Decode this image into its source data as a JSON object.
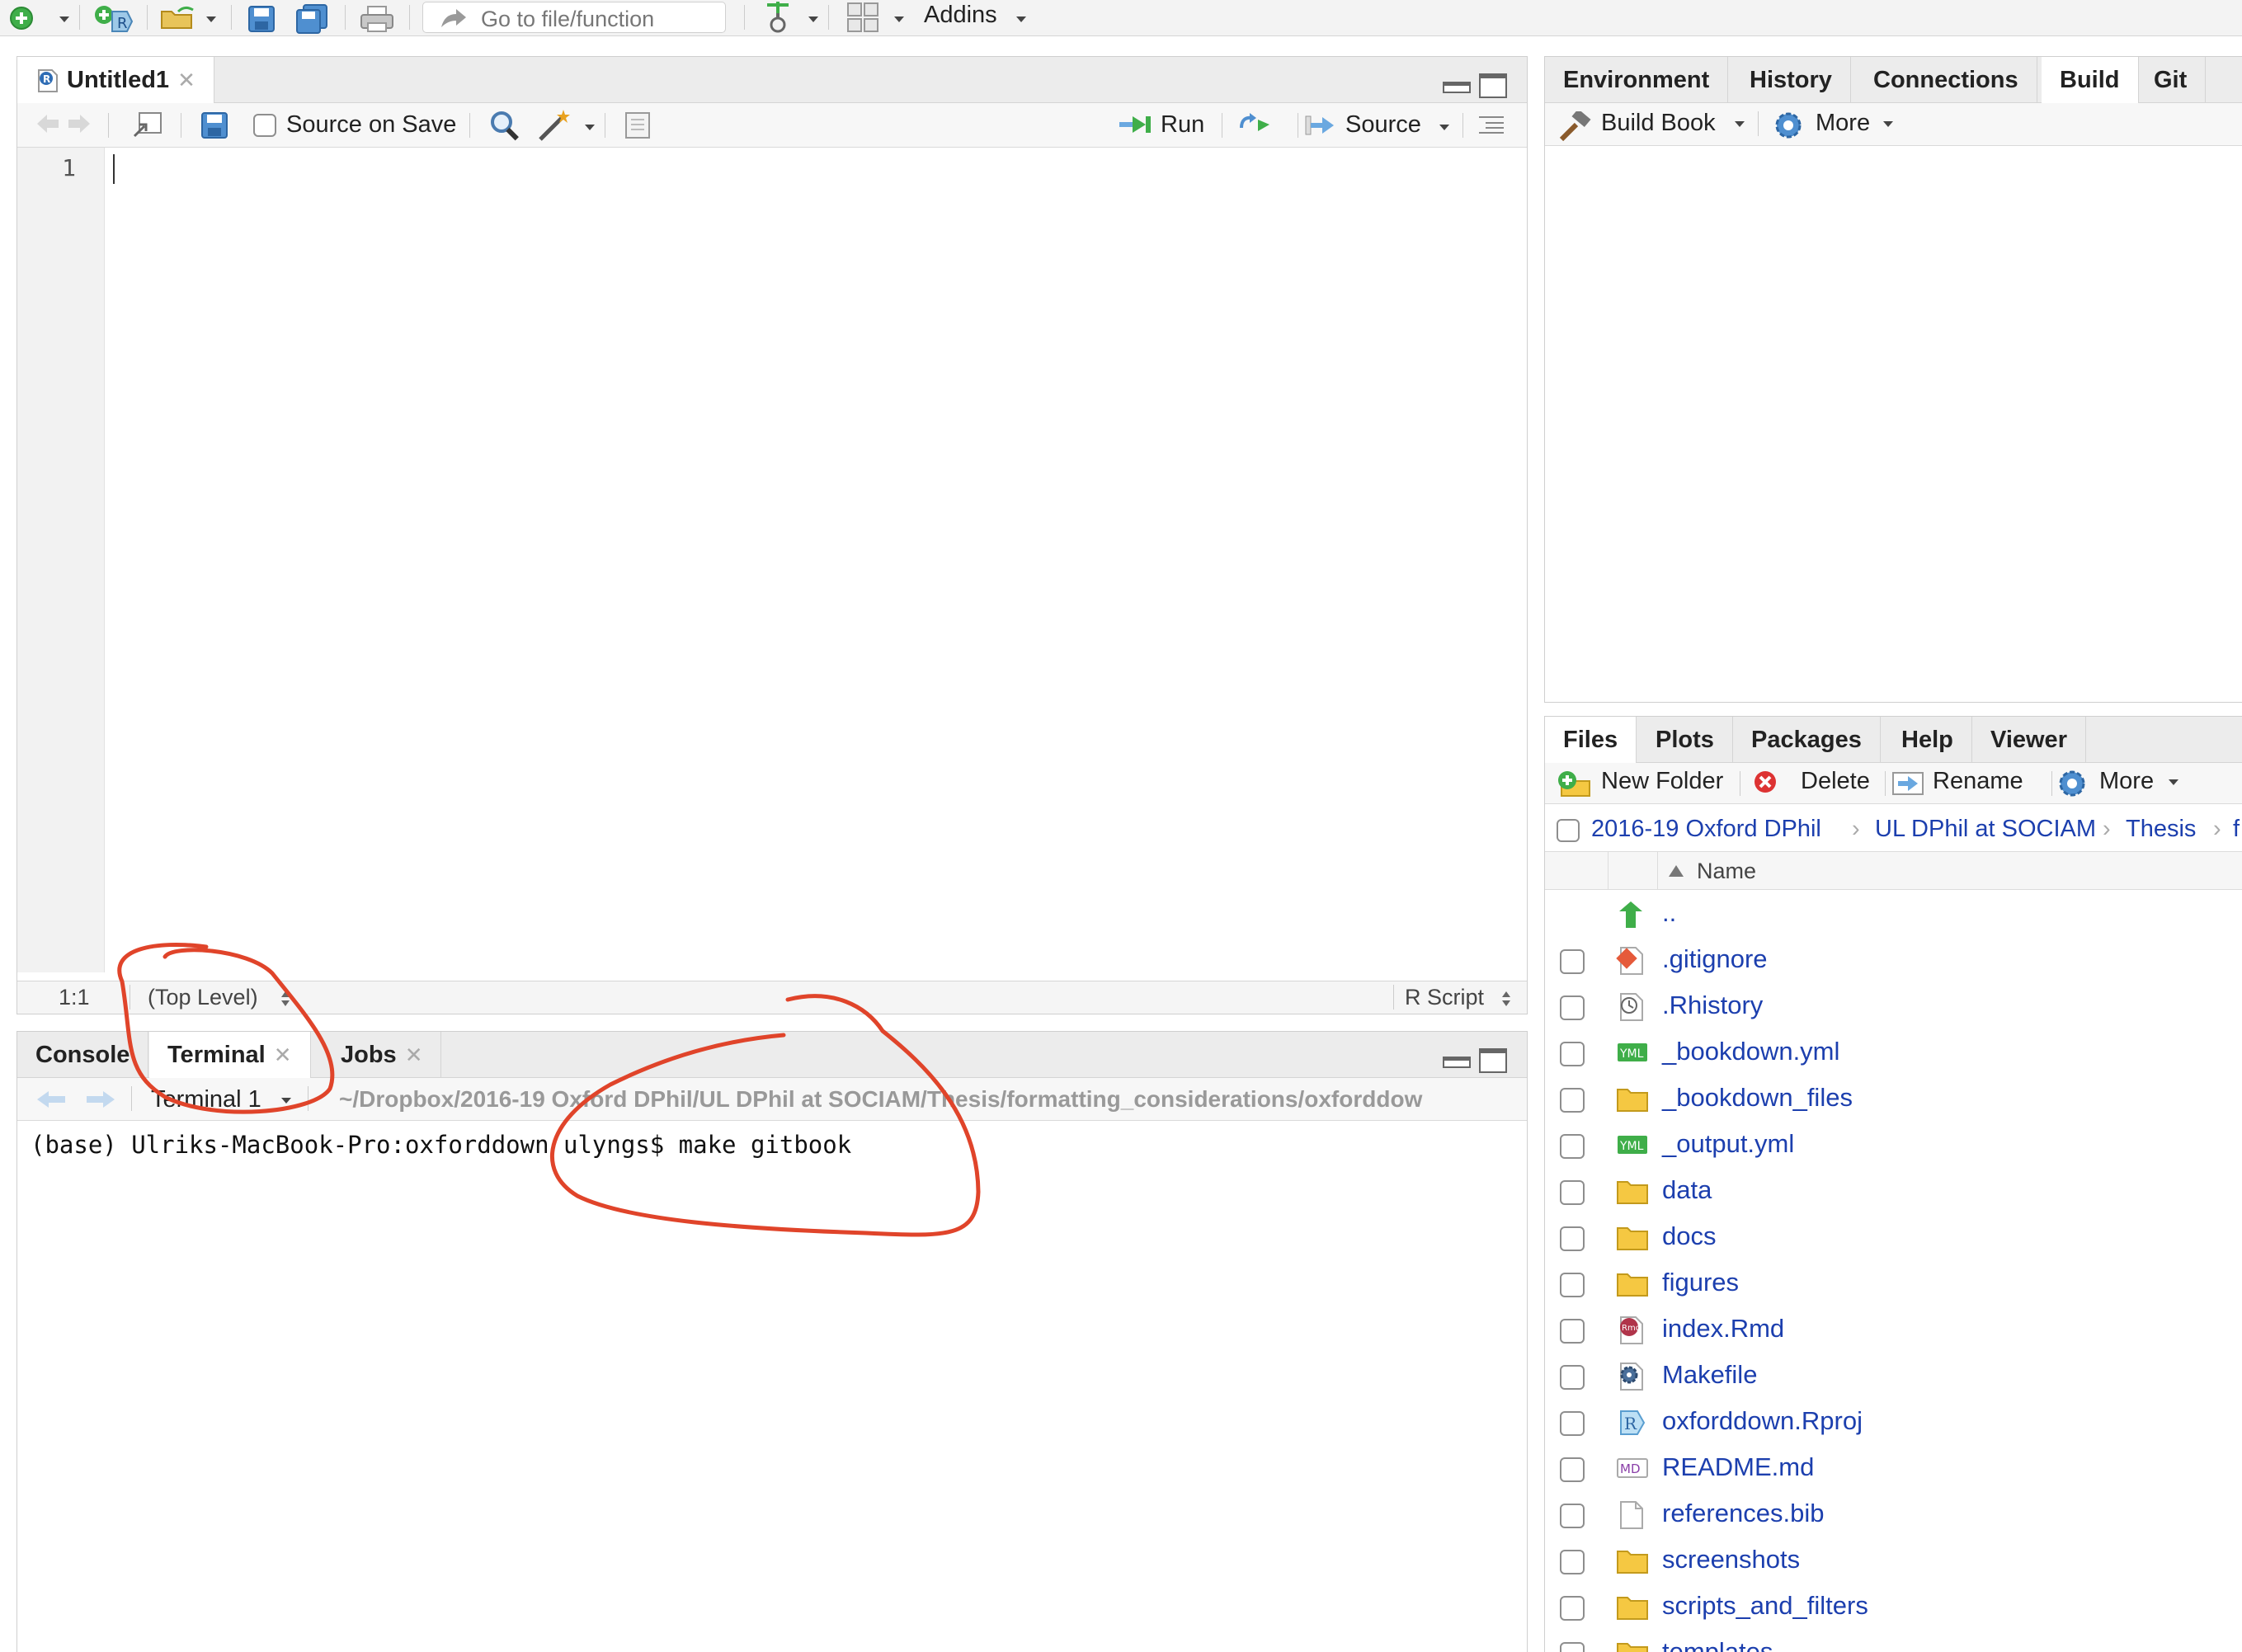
{
  "toolbar": {
    "goto_placeholder": "Go to file/function",
    "addins_label": "Addins"
  },
  "source_pane": {
    "tab_label": "Untitled1",
    "source_on_save_label": "Source on Save",
    "run_label": "Run",
    "source_label": "Source",
    "line_number": "1",
    "cursor_position": "1:1",
    "scope_label": "(Top Level)",
    "file_type": "R Script"
  },
  "console_pane": {
    "tabs": [
      "Console",
      "Terminal",
      "Jobs"
    ],
    "terminal_selector": "Terminal 1",
    "path": "~/Dropbox/2016-19 Oxford DPhil/UL DPhil at SOCIAM/Thesis/formatting_considerations/oxforddow",
    "terminal_line": "(base) Ulriks-MacBook-Pro:oxforddown ulyngs$ make gitbook"
  },
  "env_pane": {
    "tabs": [
      "Environment",
      "History",
      "Connections",
      "Build",
      "Git"
    ],
    "active_tab": "Build",
    "build_book_label": "Build Book",
    "more_label": "More"
  },
  "files_pane": {
    "tabs": [
      "Files",
      "Plots",
      "Packages",
      "Help",
      "Viewer"
    ],
    "active_tab": "Files",
    "new_folder_label": "New Folder",
    "delete_label": "Delete",
    "rename_label": "Rename",
    "more_label": "More",
    "breadcrumb": [
      "2016-19 Oxford DPhil",
      "UL DPhil at SOCIAM",
      "Thesis",
      "f"
    ],
    "name_header": "Name",
    "parent_dir": "..",
    "files": [
      {
        "name": ".gitignore",
        "icon": "git-file-icon"
      },
      {
        "name": ".Rhistory",
        "icon": "history-file-icon"
      },
      {
        "name": "_bookdown.yml",
        "icon": "yaml-file-icon"
      },
      {
        "name": "_bookdown_files",
        "icon": "folder-icon"
      },
      {
        "name": "_output.yml",
        "icon": "yaml-file-icon"
      },
      {
        "name": "data",
        "icon": "folder-icon"
      },
      {
        "name": "docs",
        "icon": "folder-icon"
      },
      {
        "name": "figures",
        "icon": "folder-icon"
      },
      {
        "name": "index.Rmd",
        "icon": "rmd-file-icon"
      },
      {
        "name": "Makefile",
        "icon": "gear-file-icon"
      },
      {
        "name": "oxforddown.Rproj",
        "icon": "rproj-file-icon"
      },
      {
        "name": "README.md",
        "icon": "md-file-icon"
      },
      {
        "name": "references.bib",
        "icon": "blank-file-icon"
      },
      {
        "name": "screenshots",
        "icon": "folder-icon"
      },
      {
        "name": "scripts_and_filters",
        "icon": "folder-icon"
      },
      {
        "name": "templates",
        "icon": "folder-icon"
      }
    ]
  },
  "colors": {
    "annotation_red": "#e0442a",
    "link_blue": "#1c3fae",
    "folder_yellow": "#f5c842"
  }
}
